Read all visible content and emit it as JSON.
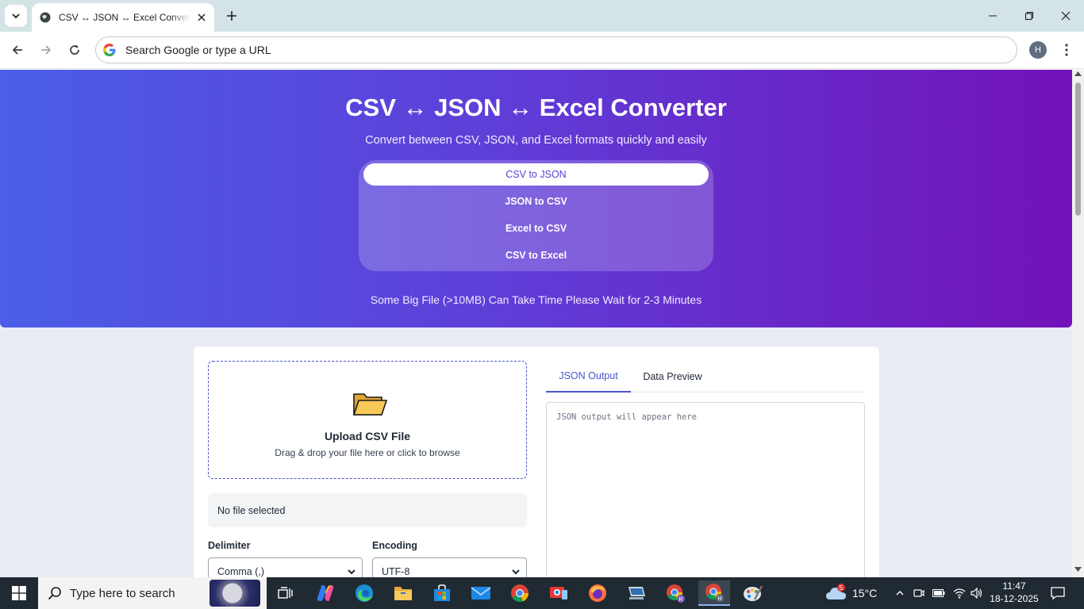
{
  "browser": {
    "tab_title": "CSV ↔ JSON ↔ Excel Converter",
    "omnibox_placeholder": "Search Google or type a URL",
    "profile_initial": "H"
  },
  "hero": {
    "title": "CSV ↔ JSON ↔ Excel Converter",
    "subtitle": "Convert between CSV, JSON, and Excel formats quickly and easily",
    "modes": [
      "CSV to JSON",
      "JSON to CSV",
      "Excel to CSV",
      "CSV to Excel"
    ],
    "active_mode": "CSV to JSON",
    "note": "Some Big File (>10MB) Can Take Time Please Wait for 2-3 Minutes"
  },
  "upload": {
    "title": "Upload CSV File",
    "subtitle": "Drag & drop your file here or click to browse",
    "file_status": "No file selected"
  },
  "options": {
    "delimiter_label": "Delimiter",
    "delimiter_value": "Comma (,)",
    "encoding_label": "Encoding",
    "encoding_value": "UTF-8"
  },
  "output": {
    "tabs": [
      "JSON Output",
      "Data Preview"
    ],
    "active_tab": "JSON Output",
    "placeholder": "JSON output will appear here"
  },
  "taskbar": {
    "search_placeholder": "Type here to search",
    "weather": "15°C",
    "weather_badge": "5",
    "time": "11:47",
    "date": "18-12-2025"
  },
  "colors": {
    "accent": "#4a55c9",
    "hero_start": "#4a5ee8",
    "hero_end": "#7212b8"
  }
}
